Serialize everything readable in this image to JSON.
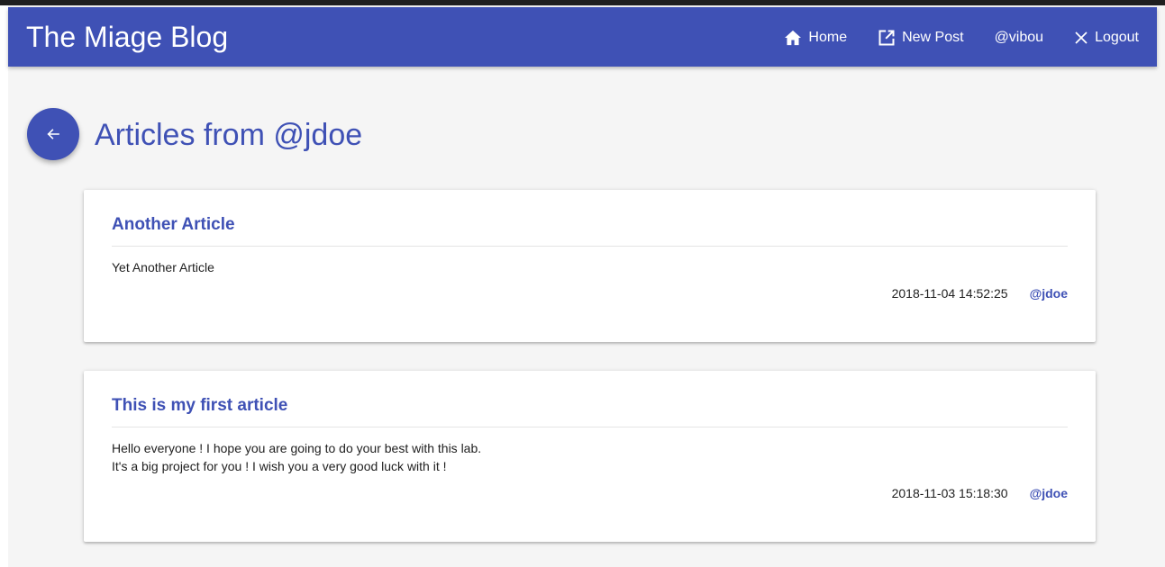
{
  "appbar": {
    "brand": "The Miage Blog",
    "nav": {
      "home": "Home",
      "new_post": "New Post",
      "user": "@vibou",
      "logout": "Logout"
    }
  },
  "page": {
    "title": "Articles from @jdoe"
  },
  "articles": [
    {
      "title": "Another Article",
      "body_lines": [
        "Yet Another Article"
      ],
      "date": "2018-11-04 14:52:25",
      "author": "@jdoe"
    },
    {
      "title": "This is my first article",
      "body_lines": [
        "Hello everyone ! I hope you are going to do your best with this lab.",
        "It's a big project for you ! I wish you a very good luck with it !"
      ],
      "date": "2018-11-03 15:18:30",
      "author": "@jdoe"
    }
  ],
  "colors": {
    "primary": "#3f51b5",
    "background": "#f5f5f5",
    "card": "#ffffff",
    "text": "#212121"
  },
  "icons": {
    "home": "home-icon",
    "new_post": "open-in-new-icon",
    "logout": "close-icon",
    "back": "arrow-left-icon"
  }
}
